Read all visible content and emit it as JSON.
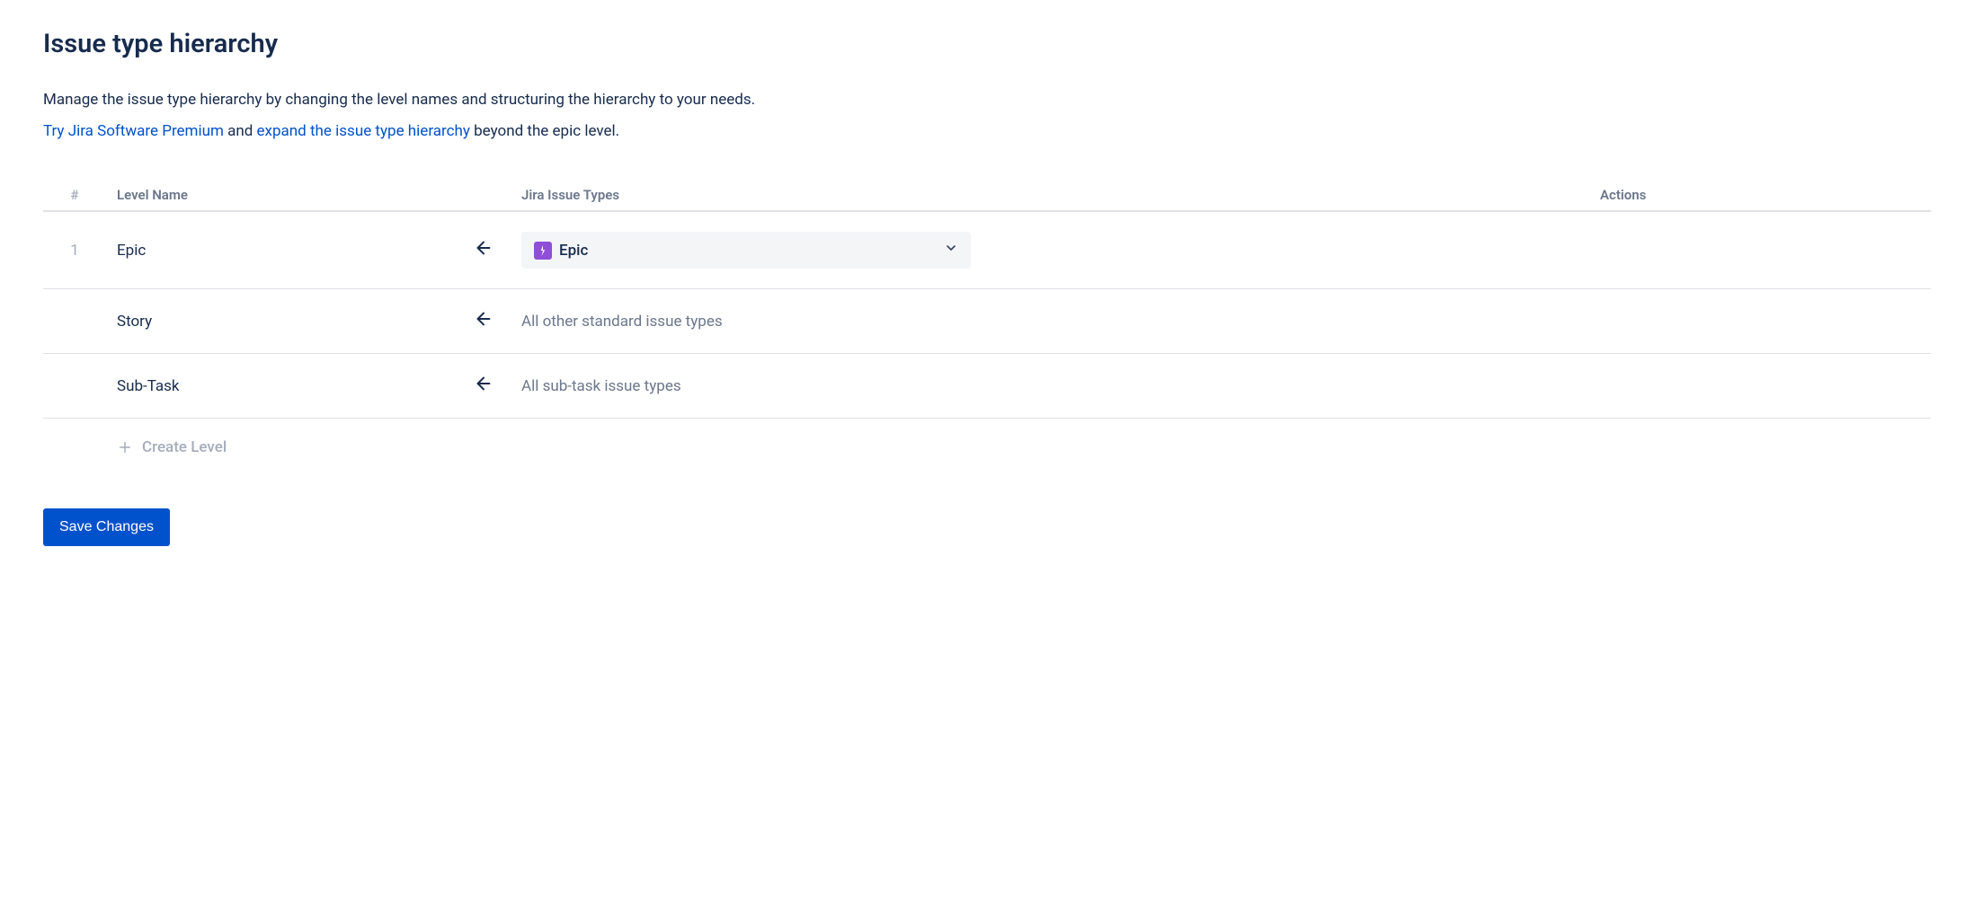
{
  "page": {
    "title": "Issue type hierarchy",
    "description": "Manage the issue type hierarchy by changing the level names and structuring the hierarchy to your needs.",
    "premium_link": "Try Jira Software Premium",
    "and_text": " and ",
    "expand_link": "expand the issue type hierarchy",
    "beyond_text": " beyond the epic level."
  },
  "table": {
    "headers": {
      "num": "#",
      "level_name": "Level Name",
      "issue_types": "Jira Issue Types",
      "actions": "Actions"
    },
    "rows": [
      {
        "num": "1",
        "level_name": "Epic",
        "issue_type_display": "Epic",
        "has_dropdown": true
      },
      {
        "num": "",
        "level_name": "Story",
        "issue_type_display": "All other standard issue types",
        "has_dropdown": false
      },
      {
        "num": "",
        "level_name": "Sub-Task",
        "issue_type_display": "All sub-task issue types",
        "has_dropdown": false
      }
    ]
  },
  "create_level": "Create Level",
  "save_button": "Save Changes"
}
